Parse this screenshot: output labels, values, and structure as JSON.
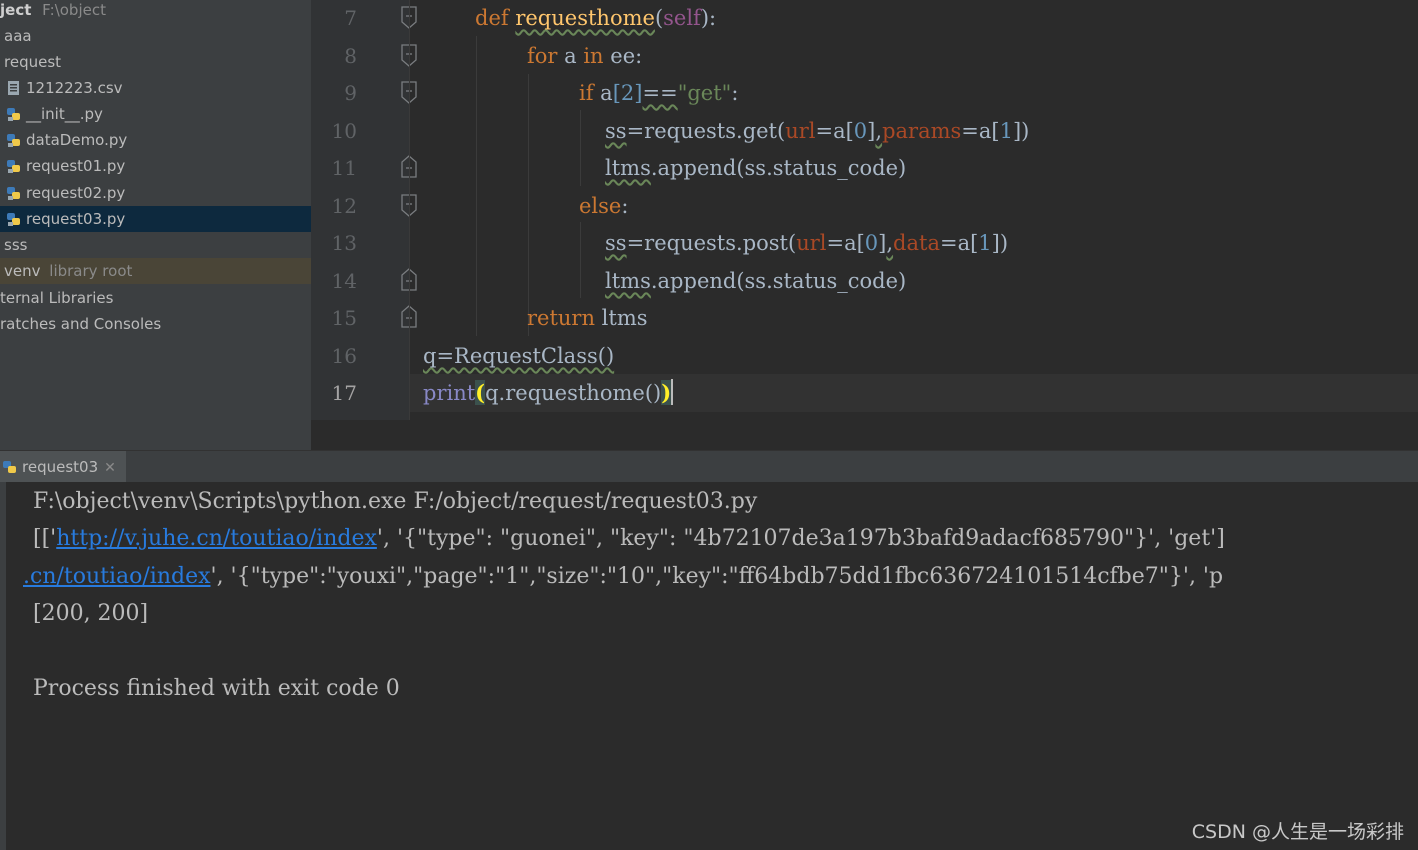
{
  "project": {
    "title_bold": "ject",
    "title_path": "F:\\object",
    "items": [
      {
        "label": "aaa",
        "type": "folder"
      },
      {
        "label": "request",
        "type": "folder"
      },
      {
        "label": "1212223.csv",
        "type": "csv-file-icon"
      },
      {
        "label": "__init__.py",
        "type": "python-file-icon"
      },
      {
        "label": "dataDemo.py",
        "type": "python-file-icon"
      },
      {
        "label": "request01.py",
        "type": "python-file-icon"
      },
      {
        "label": "request02.py",
        "type": "python-file-icon"
      },
      {
        "label": "request03.py",
        "type": "python-file-icon",
        "selected": true
      },
      {
        "label": "sss",
        "type": "folder"
      },
      {
        "label": "venv",
        "secondary": "library root",
        "type": "folder"
      },
      {
        "label": "ternal Libraries",
        "type": "folder"
      },
      {
        "label": "ratches and Consoles",
        "type": "folder"
      }
    ]
  },
  "editor": {
    "line_numbers": [
      "7",
      "8",
      "9",
      "10",
      "11",
      "12",
      "13",
      "14",
      "15",
      "16",
      "17"
    ],
    "current_line": "17",
    "code": {
      "l7": {
        "kw": "def",
        "fn": "requesthome",
        "open": "(",
        "self": "self",
        "close": "):"
      },
      "l8": {
        "kw1": "for",
        "var": " a ",
        "kw2": "in",
        "rest": " ee:"
      },
      "l9": {
        "kw": "if",
        "a": " a",
        "lb": "[",
        "idx": "2",
        "rb": "]",
        "eq": "==",
        "str": "\"get\"",
        "colon": ":"
      },
      "l10": {
        "ss": "ss",
        "mid": "=requests.get(",
        "p1": "url",
        "eq1": "=a[",
        "n0": "0",
        "mid2": "]",
        "comma": ",",
        "p2": "params",
        "eq2": "=a[",
        "n1": "1",
        "end": "])"
      },
      "l11": {
        "ltms": "ltms",
        "rest": ".append(ss.status_code)"
      },
      "l12": {
        "kw": "else",
        "colon": ":"
      },
      "l13": {
        "ss": "ss",
        "mid": "=requests.post(",
        "p1": "url",
        "eq1": "=a[",
        "n0": "0",
        "mid2": "]",
        "comma": ",",
        "p2": "data",
        "eq2": "=a[",
        "n1": "1",
        "end": "])"
      },
      "l14": {
        "ltms": "ltms",
        "rest": ".append(ss.status_code)"
      },
      "l15": {
        "kw": "return",
        "rest": " ltms"
      },
      "l16": {
        "text": "q=RequestClass()"
      },
      "l17": {
        "print": "print",
        "open": "(",
        "mid": "q.requesthome()",
        "close": ")"
      }
    }
  },
  "run": {
    "tab_label": "request03",
    "console": {
      "line1": "F:\\object\\venv\\Scripts\\python.exe F:/object/request/request03.py",
      "line2_prefix": "[['",
      "line2_link": "http://v.juhe.cn/toutiao/index",
      "line2_rest": "', '{\"type\": \"guonei\", \"key\": \"4b72107de3a197b3bafd9adacf685790\"}', 'get']",
      "line3_link": ".cn/toutiao/index",
      "line3_rest": "', '{\"type\":\"youxi\",\"page\":\"1\",\"size\":\"10\",\"key\":\"ff64bdb75dd1fbc636724101514cfbe7\"}', 'p",
      "line4": "[200, 200]",
      "line6": "Process finished with exit code 0"
    }
  },
  "watermark": "CSDN @人生是一场彩排",
  "colors": {
    "keyword": "#cc7832",
    "function": "#ffc66d",
    "string": "#6a8759",
    "number": "#6897bb",
    "param": "#aa4926",
    "self": "#94558d",
    "link": "#287bde",
    "selection": "#0d293e"
  }
}
